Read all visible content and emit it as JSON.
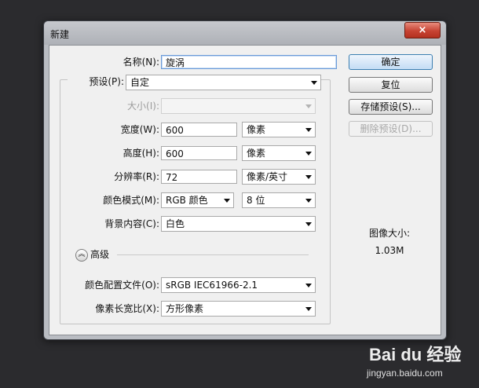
{
  "window": {
    "title": "新建",
    "close_icon": "×"
  },
  "form": {
    "name_label": "名称(N):",
    "name_value": "旋涡",
    "preset_label": "预设(P):",
    "preset_value": "自定",
    "size_label": "大小(I):",
    "size_value": "",
    "width_label": "宽度(W):",
    "width_value": "600",
    "width_unit": "像素",
    "height_label": "高度(H):",
    "height_value": "600",
    "height_unit": "像素",
    "resolution_label": "分辨率(R):",
    "resolution_value": "72",
    "resolution_unit": "像素/英寸",
    "color_mode_label": "颜色模式(M):",
    "color_mode_value": "RGB 颜色",
    "bit_depth_value": "8 位",
    "background_label": "背景内容(C):",
    "background_value": "白色",
    "advanced_label": "高级",
    "advanced_icon": "chevron-up-double-icon",
    "color_profile_label": "颜色配置文件(O):",
    "color_profile_value": "sRGB IEC61966-2.1",
    "pixel_aspect_label": "像素长宽比(X):",
    "pixel_aspect_value": "方形像素"
  },
  "buttons": {
    "ok": "确定",
    "reset": "复位",
    "save_preset": "存储预设(S)...",
    "delete_preset": "删除预设(D)..."
  },
  "image_info": {
    "label": "图像大小:",
    "value": "1.03M"
  },
  "watermark": {
    "logo": "Bai du 经验",
    "url": "jingyan.baidu.com"
  },
  "colors": {
    "default_button_border": "#3c7fb1",
    "close_button": "#c74333",
    "background": "#2b2b2e"
  }
}
